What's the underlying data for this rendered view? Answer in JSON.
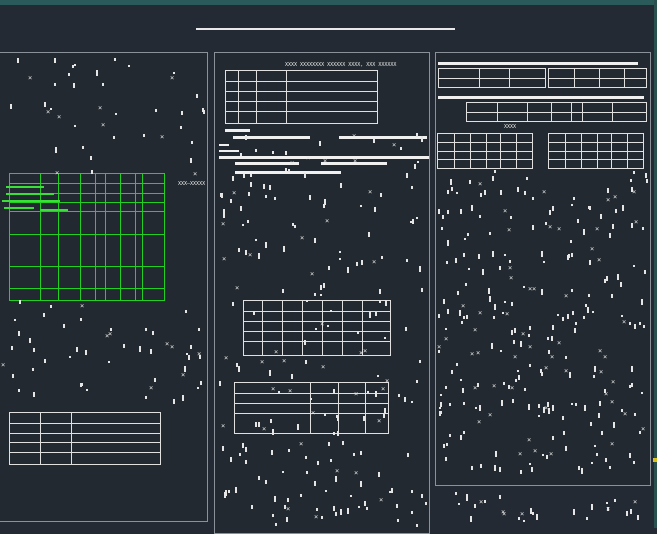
{
  "canvas": {
    "background": "#232a33",
    "frame_accent": "#2a5a5a",
    "linework": "#e0e0e0",
    "highlight": "#22d022"
  },
  "sheet1": {
    "note_right": "XXX—XXXXX",
    "green_lines": [
      "XXXX XXXXXX XXXXX",
      "XX XXXXXX XX XXXXXX",
      "XX XXXXX XXXXXXXX",
      "XX XXXX",
      "XX XXXXXX"
    ]
  },
  "sheet2": {
    "header_note": "XXXX XXXXXXXX XXXXXX XXXX, XXX XXXXXX"
  },
  "sheet3": {
    "table_label": "XXXX"
  }
}
